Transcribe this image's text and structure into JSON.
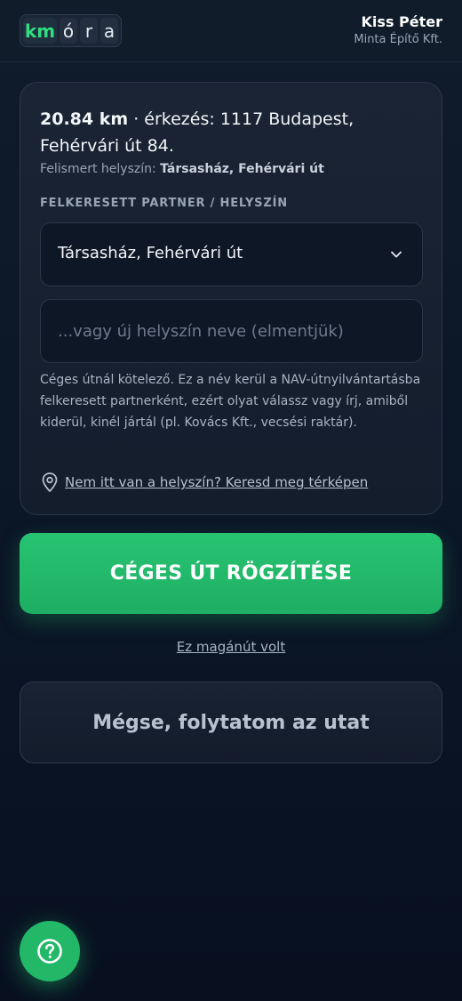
{
  "header": {
    "logo_letters": [
      "km",
      "ó",
      "r",
      "a"
    ],
    "user_name": "Kiss Péter",
    "company": "Minta Építő Kft."
  },
  "trip": {
    "distance": "20.84 km",
    "separator": " · ",
    "arrival_label": "érkezés:",
    "address": "1117 Budapest, Fehérvári út 84.",
    "recognized_label": "Felismert helyszín:",
    "recognized_value": "Társasház, Fehérvári út"
  },
  "partner": {
    "section_label": "FELKERESETT PARTNER / HELYSZÍN",
    "selected": "Társasház, Fehérvári út",
    "new_placeholder": "...vagy új helyszín neve (elmentjük)",
    "hint": "Céges útnál kötelező. Ez a név kerül a NAV-útnyilvántartásba felkeresett partnerként, ezért olyat válassz vagy írj, amiből kiderül, kinél jártál (pl. Kovács Kft., vecsési raktár).",
    "map_link": "Nem itt van a helyszín? Keresd meg térképen"
  },
  "actions": {
    "primary": "CÉGES ÚT RÖGZÍTÉSE",
    "private_link": "Ez magánút volt",
    "secondary": "Mégse, folytatom az utat"
  },
  "icons": {
    "chevron": "chevron-down-icon",
    "pin": "map-pin-icon",
    "help": "question-mark-icon"
  },
  "colors": {
    "accent_green": "#22b868",
    "logo_km": "#2fdc80",
    "background": "#0c1828"
  }
}
